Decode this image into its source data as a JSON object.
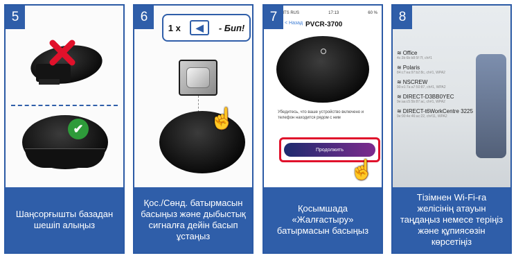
{
  "panels": [
    {
      "number": "5",
      "caption": "Шаңсорғышты базадан шешіп алыңыз"
    },
    {
      "number": "6",
      "caption": "Қос./Сөнд. батырмасын басыңыз және дыбыстық сигналға дейін басып ұстаңыз"
    },
    {
      "number": "7",
      "caption": "Қосымшада «Жалғастыру» батырмасын басыңыз"
    },
    {
      "number": "8",
      "caption": "Тізімнен Wi-Fi-ға желісінің атауын таңдаңыз немесе теріңіз және құпиясөзін көрсетіңіз"
    }
  ],
  "beep": {
    "count": "1 x",
    "label": "- Бип!",
    "icon": "speaker-icon"
  },
  "phone_screen": {
    "status_left": "MTS RUS",
    "status_time": "17:13",
    "status_right": "60 %",
    "back": "< Назад",
    "model": "PVCR-3700",
    "message": "Убедитесь, что ваше устройство включено и телефон находится рядом с ним",
    "continue": "Продолжить"
  },
  "wifi_networks": [
    {
      "name": "Office",
      "meta": "4c:3b:6b:b8:5f:7f, ch#1"
    },
    {
      "name": "Polaris",
      "meta": "84:c7:ea:97:b2:8c, ch#1, WPA2"
    },
    {
      "name": "NSCREW",
      "meta": "90:e1:7a:a7:50:87, ch#1, WPA2"
    },
    {
      "name": "DIRECT-D3BB0YEC",
      "meta": "9e:aa:c5:5b:87:ac, ch#1, WPA2"
    },
    {
      "name": "DIRECT-t6WorkCentre 3225",
      "meta": "9e:90:4e:46:ac:22, ch#11, WPA2"
    }
  ],
  "colors": {
    "accent": "#2f5ea9",
    "highlight": "#e0112b",
    "check": "#2e9b3a"
  }
}
